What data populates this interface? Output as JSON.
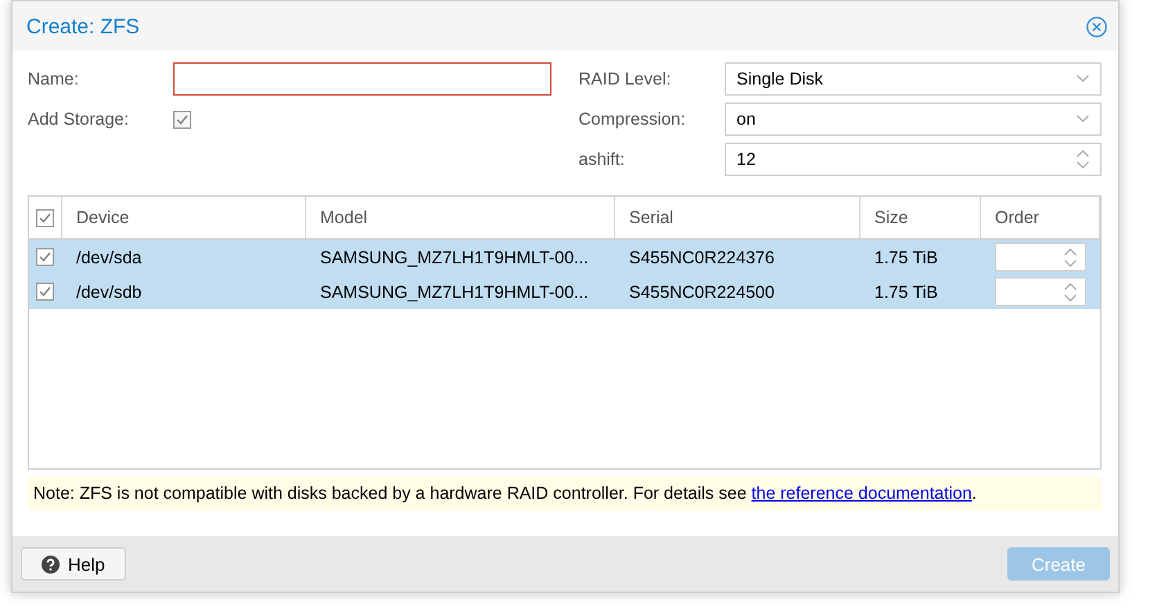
{
  "window": {
    "title": "Create: ZFS"
  },
  "form": {
    "left": [
      {
        "kind": "text",
        "label": "Name:",
        "invalid": true
      },
      {
        "kind": "checkbox",
        "label": "Add Storage:",
        "checked": true
      }
    ],
    "right": [
      {
        "kind": "combo",
        "label": "RAID Level:",
        "value": "Single Disk"
      },
      {
        "kind": "combo",
        "label": "Compression:",
        "value": "on"
      },
      {
        "kind": "spinner",
        "label": "ashift:",
        "value": "12"
      }
    ]
  },
  "table": {
    "all_checked": true,
    "columns": [
      "Device",
      "Model",
      "Serial",
      "Size",
      "Order"
    ],
    "rows": [
      {
        "selected": true,
        "checked": true,
        "device": "/dev/sda",
        "model": "SAMSUNG_MZ7LH1T9HMLT-00...",
        "serial": "S455NC0R224376",
        "size": "1.75 TiB"
      },
      {
        "selected": true,
        "checked": true,
        "device": "/dev/sdb",
        "model": "SAMSUNG_MZ7LH1T9HMLT-00...",
        "serial": "S455NC0R224500",
        "size": "1.75 TiB"
      }
    ]
  },
  "note": {
    "text": "Note: ZFS is not compatible with disks backed by a hardware RAID controller. For details see ",
    "link": "the reference documentation",
    "end": "."
  },
  "buttons": [
    {
      "kind": "help",
      "label": "Help",
      "disabled": false
    },
    {
      "kind": "primary",
      "label": "Create",
      "disabled": true
    }
  ]
}
